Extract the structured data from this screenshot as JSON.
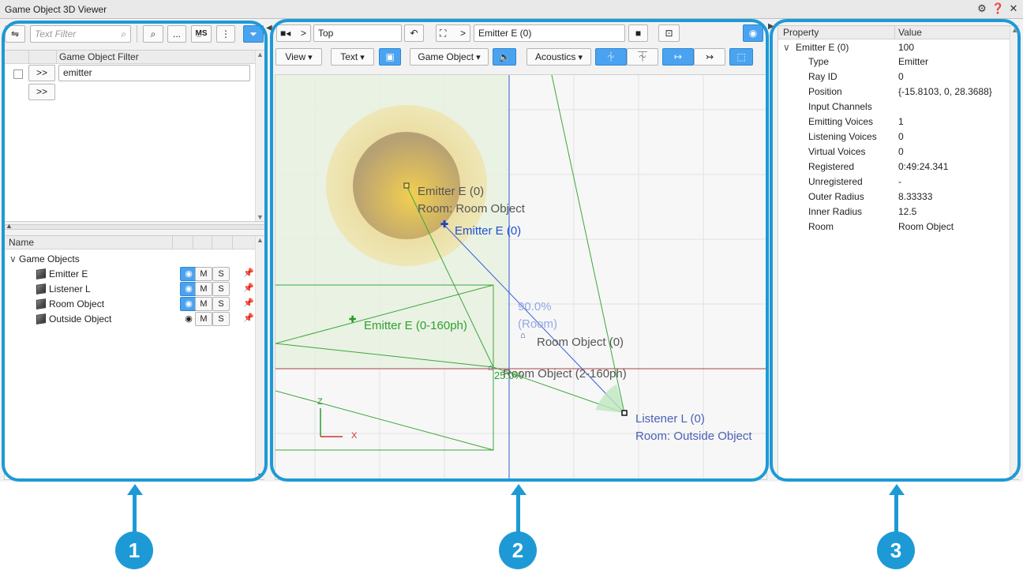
{
  "window": {
    "title": "Game Object 3D Viewer"
  },
  "left": {
    "text_filter_placeholder": "Text Filter",
    "more_label": "...",
    "filter_header": "Game Object Filter",
    "filter_arrow_1": ">>",
    "filter_arrow_2": ">>",
    "filter_value": "emitter",
    "list_header": "Name",
    "group_label": "Game Objects",
    "objects": [
      {
        "name": "Emitter E",
        "m": "M",
        "s": "S"
      },
      {
        "name": "Listener L",
        "m": "M",
        "s": "S"
      },
      {
        "name": "Room Object",
        "m": "M",
        "s": "S"
      },
      {
        "name": "Outside Object",
        "m": "M",
        "s": "S"
      }
    ]
  },
  "viewport": {
    "camera_arrow": ">",
    "camera_view": "Top",
    "target_arrow": ">",
    "target_object": "Emitter E (0)",
    "menus": {
      "view": "View",
      "text": "Text",
      "game_object": "Game Object",
      "acoustics": "Acoustics"
    },
    "labels": {
      "emitter_name": "Emitter  E (0)",
      "emitter_room": "Room: Room Object",
      "emitter_blue": "Emitter E (0)",
      "emitter_green": "Emitter E (0-160ph)",
      "pct": "90.0%",
      "pct_room": "(Room)",
      "room_object": "Room Object (0)",
      "room_object_ph": "Room Object (2-160ph)",
      "small_pct": "25.0%",
      "listener_name": "Listener  L (0)",
      "listener_room": "Room: Outside Object",
      "axis_z": "Z",
      "axis_x": "X"
    }
  },
  "properties": {
    "col_property": "Property",
    "col_value": "Value",
    "root": {
      "name": "Emitter E (0)",
      "value": "100"
    },
    "rows": [
      {
        "name": "Type",
        "value": "Emitter"
      },
      {
        "name": "Ray ID",
        "value": "0"
      },
      {
        "name": "Position",
        "value": "{-15.8103, 0, 28.3688}"
      },
      {
        "name": "Input Channels",
        "value": ""
      },
      {
        "name": "Emitting Voices",
        "value": "1"
      },
      {
        "name": "Listening Voices",
        "value": "0"
      },
      {
        "name": "Virtual Voices",
        "value": "0"
      },
      {
        "name": "Registered",
        "value": "0:49:24.341"
      },
      {
        "name": "Unregistered",
        "value": "-"
      },
      {
        "name": "Outer Radius",
        "value": "8.33333"
      },
      {
        "name": "Inner Radius",
        "value": "12.5"
      },
      {
        "name": "Room",
        "value": "Room Object"
      }
    ]
  },
  "callouts": {
    "one": "1",
    "two": "2",
    "three": "3"
  },
  "colors": {
    "accent": "#1d9ad6",
    "toggle_on": "#4aa3f0",
    "emitter_green": "#2ea02e",
    "ray_blue": "#1f4fd6"
  }
}
